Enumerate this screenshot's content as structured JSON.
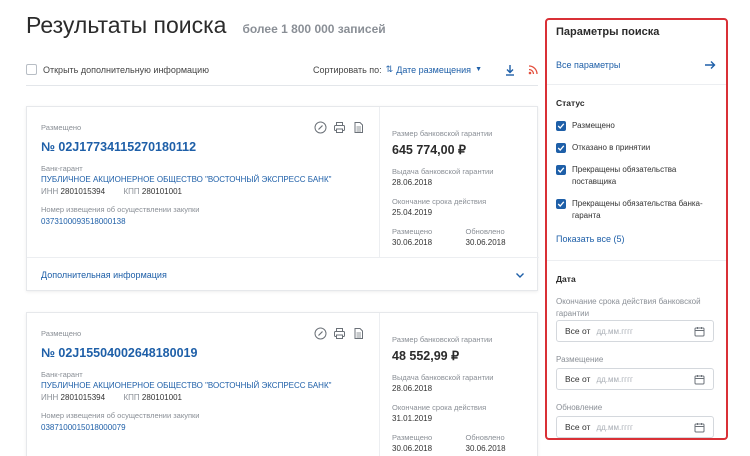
{
  "header": {
    "title": "Результаты поиска",
    "count": "более 1 800 000 записей"
  },
  "toolbar": {
    "more_info_label": "Открыть дополнительную информацию",
    "sort_label": "Сортировать по:",
    "sort_value": "Дате размещения"
  },
  "cards": [
    {
      "placement_label": "Размещено",
      "number": "№ 02J17734115270180112",
      "bank_label": "Банк-гарант",
      "bank_name": "ПУБЛИЧНОЕ АКЦИОНЕРНОЕ ОБЩЕСТВО \"ВОСТОЧНЫЙ ЭКСПРЕСС БАНК\"",
      "inn_label": "ИНН",
      "inn": "2801015394",
      "kpp_label": "КПП",
      "kpp": "280101001",
      "purchase_label": "Номер извещения об осуществлении закупки",
      "purchase_number": "0373100093518000138",
      "amount_label": "Размер банковской гарантии",
      "amount": "645 774,00 ₽",
      "issue_label": "Выдача банковской гарантии",
      "issue_date": "28.06.2018",
      "end_label": "Окончание срока действия",
      "end_date": "25.04.2019",
      "placed_label": "Размещено",
      "placed_date": "30.06.2018",
      "updated_label": "Обновлено",
      "updated_date": "30.06.2018",
      "footer_label": "Дополнительная информация"
    },
    {
      "placement_label": "Размещено",
      "number": "№ 02J15504002648180019",
      "bank_label": "Банк-гарант",
      "bank_name": "ПУБЛИЧНОЕ АКЦИОНЕРНОЕ ОБЩЕСТВО \"ВОСТОЧНЫЙ ЭКСПРЕСС БАНК\"",
      "inn_label": "ИНН",
      "inn": "2801015394",
      "kpp_label": "КПП",
      "kpp": "280101001",
      "purchase_label": "Номер извещения об осуществлении закупки",
      "purchase_number": "0387100015018000079",
      "amount_label": "Размер банковской гарантии",
      "amount": "48 552,99 ₽",
      "issue_label": "Выдача банковской гарантии",
      "issue_date": "28.06.2018",
      "end_label": "Окончание срока действия",
      "end_date": "31.01.2019",
      "placed_label": "Размещено",
      "placed_date": "30.06.2018",
      "updated_label": "Обновлено",
      "updated_date": "30.06.2018"
    }
  ],
  "sidebar": {
    "title": "Параметры поиска",
    "all_params": "Все параметры",
    "status_title": "Статус",
    "statuses": [
      "Размещено",
      "Отказано в принятии",
      "Прекращены обязательства поставщика",
      "Прекращены обязательства банка-гаранта"
    ],
    "show_all": "Показать все (5)",
    "date_title": "Дата",
    "date_fields": [
      {
        "label": "Окончание срока действия банковской гарантии",
        "prefix": "Все от",
        "placeholder": "дд.мм.гггг"
      },
      {
        "label": "Размещение",
        "prefix": "Все от",
        "placeholder": "дд.мм.гггг"
      },
      {
        "label": "Обновление",
        "prefix": "Все от",
        "placeholder": "дд.мм.гггг"
      }
    ]
  }
}
